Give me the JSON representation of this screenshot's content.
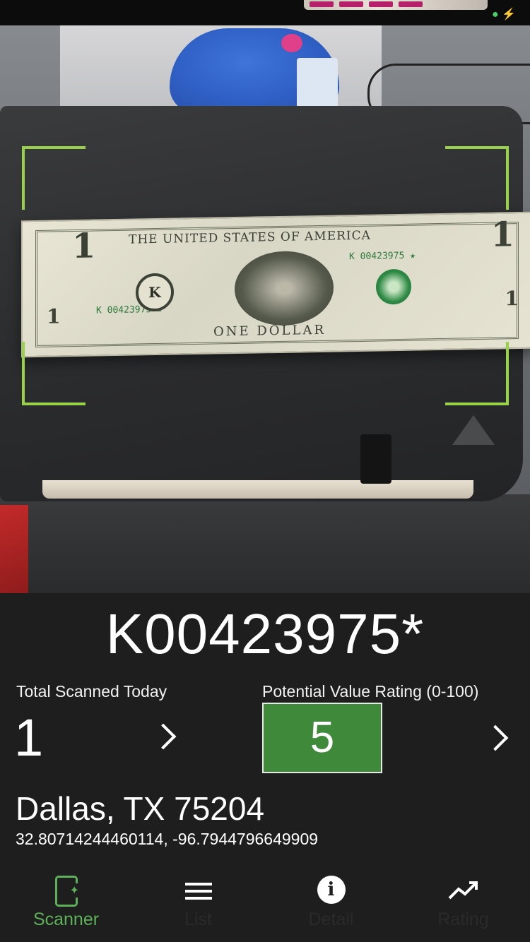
{
  "camera": {
    "note": {
      "header": "THE UNITED STATES OF AMERICA",
      "footer": "ONE DOLLAR",
      "serial": "K 00423975 ★",
      "seal_letter": "K",
      "denomination": "1"
    }
  },
  "scan": {
    "serial_number": "K00423975*"
  },
  "stats": {
    "total_label": "Total Scanned Today",
    "total_value": "1",
    "rating_label": "Potential Value Rating (0-100)",
    "rating_value": "5",
    "rating_color": "#3f8a3a"
  },
  "location": {
    "city": "Dallas, TX 75204",
    "coordinates": "32.80714244460114, -96.7944796649909"
  },
  "tabs": [
    {
      "label": "Scanner",
      "icon": "scanner-phone-icon",
      "active": true
    },
    {
      "label": "List",
      "icon": "list-icon",
      "active": false
    },
    {
      "label": "Detail",
      "icon": "info-icon",
      "active": false
    },
    {
      "label": "Rating",
      "icon": "trending-up-icon",
      "active": false
    }
  ],
  "colors": {
    "accent": "#5fb05a",
    "bracket": "#9ad14a",
    "background": "#1e1e1e"
  }
}
